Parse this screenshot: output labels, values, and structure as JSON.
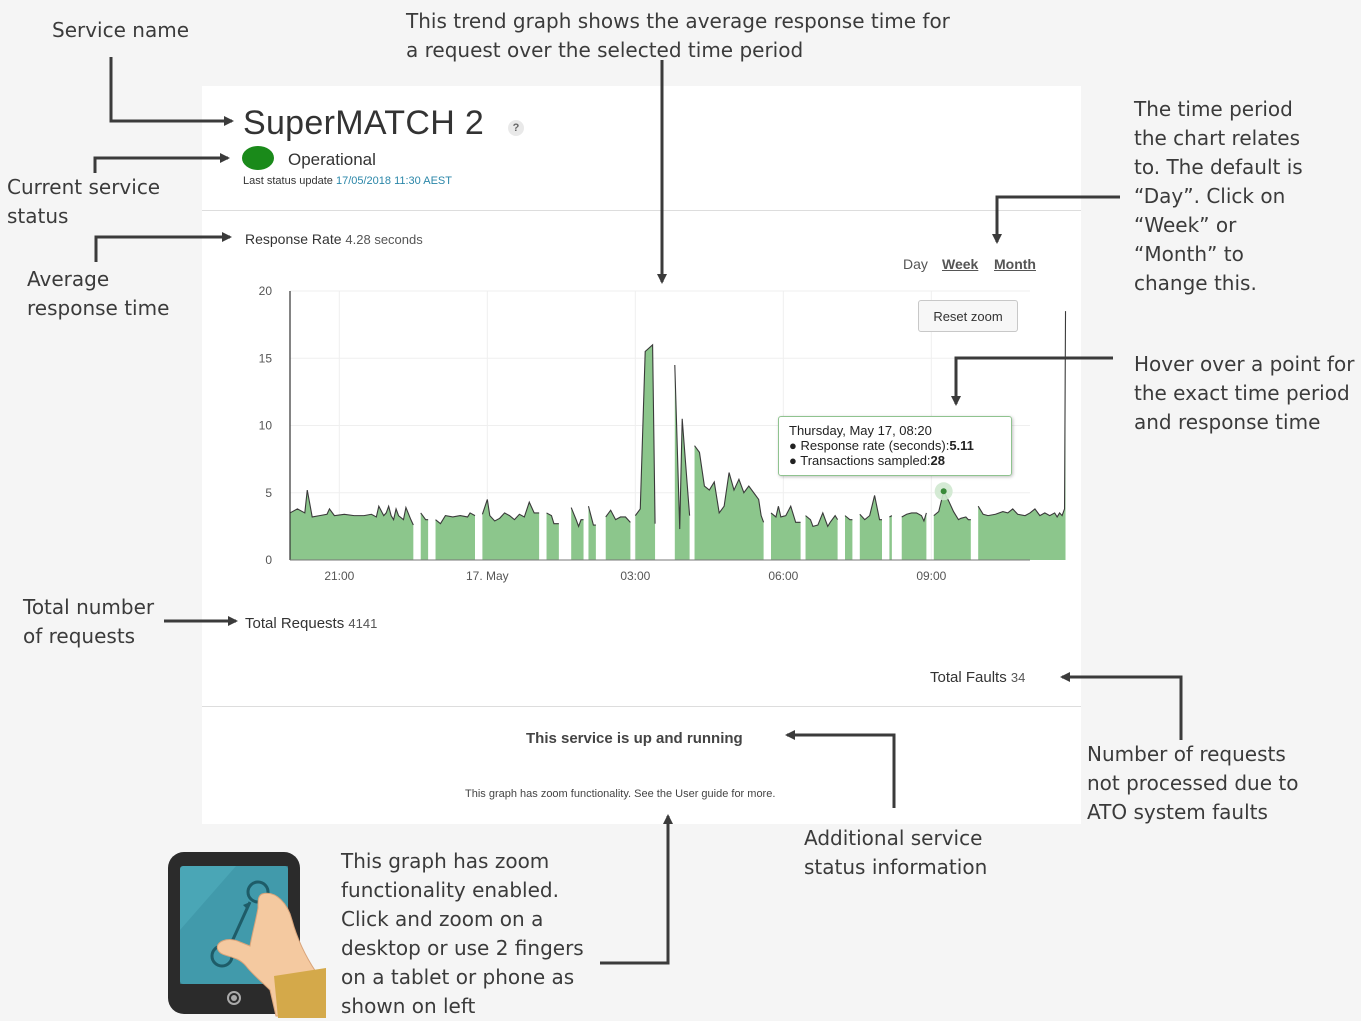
{
  "annotations": {
    "service_name": "Service name",
    "trend_graph": "This trend graph shows the average response time for\na request over the selected time period",
    "current_status": "Current service\nstatus",
    "average_response": "Average\nresponse time",
    "time_period": "The time period\nthe chart relates\nto. The default is\n“Day”. Click on\n“Week” or\n“Month” to\nchange this.",
    "hover": "Hover over a point for\nthe exact time period\nand response time",
    "total_requests": "Total number\nof requests",
    "faults": "Number of requests\nnot processed due to\nATO system faults",
    "additional_info": "Additional service\nstatus information",
    "zoom": "This graph has zoom\nfunctionality enabled.\nClick and zoom on a\ndesktop or use 2 fingers\non a tablet or phone as\nshown on left"
  },
  "service": {
    "title": "SuperMATCH 2",
    "help_icon": "?",
    "status": "Operational",
    "status_color": "#1a8a1a",
    "last_update_label": "Last status update",
    "last_update_value": "17/05/2018 11:30 AEST"
  },
  "response_rate": {
    "label": "Response Rate",
    "value": "4.28 seconds"
  },
  "period_tabs": [
    "Day",
    "Week",
    "Month"
  ],
  "reset_zoom": "Reset zoom",
  "tooltip": {
    "title": "Thursday, May 17, 08:20",
    "line1_label": "Response rate (seconds):",
    "line1_value": "5.11",
    "line2_label": "Transactions sampled:",
    "line2_value": "28"
  },
  "totals": {
    "requests_label": "Total Requests",
    "requests_value": "4141",
    "faults_label": "Total Faults",
    "faults_value": "34"
  },
  "footer": {
    "status_message": "This service is up and running",
    "zoom_note": "This graph has zoom functionality. See the User guide for more."
  },
  "chart_data": {
    "type": "area",
    "color": "#8cc68c",
    "line_color": "#3a3a3a",
    "ylim": [
      0,
      20
    ],
    "yticks": [
      "0",
      "5",
      "10",
      "15",
      "20"
    ],
    "xtick_labels": [
      "21:00",
      "17. May",
      "03:00",
      "06:00",
      "09:00"
    ],
    "xtick_hours": [
      21,
      24,
      27,
      30,
      33
    ],
    "x_range_hours": [
      20.0,
      35.0
    ],
    "series": [
      {
        "segments": [
          [
            [
              20.0,
              3.5
            ],
            [
              20.15,
              3.8
            ],
            [
              20.3,
              3.5
            ],
            [
              20.35,
              5.2
            ],
            [
              20.45,
              3.2
            ],
            [
              20.6,
              3.3
            ],
            [
              20.75,
              3.4
            ],
            [
              20.8,
              3.8
            ],
            [
              20.9,
              3.3
            ],
            [
              21.1,
              3.4
            ],
            [
              21.3,
              3.3
            ],
            [
              21.5,
              3.3
            ],
            [
              21.65,
              3.4
            ],
            [
              21.75,
              3.2
            ],
            [
              21.8,
              4.0
            ],
            [
              21.9,
              3.3
            ],
            [
              21.95,
              3.5
            ],
            [
              22.0,
              4.0
            ],
            [
              22.05,
              3.3
            ],
            [
              22.1,
              3.0
            ],
            [
              22.15,
              3.8
            ],
            [
              22.2,
              3.3
            ],
            [
              22.3,
              3.0
            ],
            [
              22.35,
              3.9
            ],
            [
              22.45,
              3.0
            ],
            [
              22.5,
              2.6
            ]
          ],
          [
            [
              22.65,
              3.5
            ],
            [
              22.75,
              3.0
            ],
            [
              22.8,
              3.0
            ]
          ],
          [
            [
              22.95,
              3.0
            ],
            [
              23.05,
              2.7
            ],
            [
              23.15,
              3.3
            ],
            [
              23.3,
              3.2
            ],
            [
              23.45,
              3.3
            ],
            [
              23.6,
              3.2
            ],
            [
              23.65,
              3.5
            ],
            [
              23.75,
              3.3
            ]
          ],
          [
            [
              23.9,
              3.4
            ],
            [
              24.0,
              4.5
            ],
            [
              24.05,
              3.3
            ],
            [
              24.15,
              2.9
            ],
            [
              24.25,
              3.1
            ],
            [
              24.35,
              3.5
            ],
            [
              24.45,
              3.3
            ],
            [
              24.55,
              3.0
            ],
            [
              24.65,
              3.4
            ],
            [
              24.75,
              3.2
            ],
            [
              24.85,
              4.3
            ],
            [
              24.95,
              3.5
            ],
            [
              25.05,
              3.5
            ]
          ],
          [
            [
              25.2,
              3.5
            ],
            [
              25.3,
              3.3
            ],
            [
              25.35,
              2.7
            ],
            [
              25.45,
              2.7
            ]
          ],
          [
            [
              25.7,
              3.9
            ],
            [
              25.8,
              3.0
            ],
            [
              25.85,
              2.5
            ],
            [
              25.9,
              3.0
            ],
            [
              25.95,
              3.0
            ]
          ],
          [
            [
              26.05,
              4.0
            ],
            [
              26.15,
              2.6
            ],
            [
              26.2,
              2.6
            ]
          ],
          [
            [
              26.4,
              3.2
            ],
            [
              26.5,
              3.7
            ],
            [
              26.6,
              3.0
            ],
            [
              26.7,
              3.2
            ],
            [
              26.8,
              3.2
            ],
            [
              26.9,
              2.8
            ]
          ],
          [
            [
              27.0,
              3.3
            ],
            [
              27.1,
              3.8
            ],
            [
              27.2,
              15.5
            ],
            [
              27.35,
              16.0
            ],
            [
              27.4,
              2.7
            ]
          ],
          [
            [
              27.8,
              14.5
            ],
            [
              27.9,
              2.3
            ],
            [
              27.95,
              10.5
            ],
            [
              28.1,
              3.3
            ]
          ],
          [
            [
              28.2,
              8.5
            ],
            [
              28.3,
              8.0
            ],
            [
              28.4,
              5.5
            ],
            [
              28.5,
              5.2
            ],
            [
              28.6,
              5.8
            ],
            [
              28.7,
              3.5
            ],
            [
              28.8,
              4.0
            ],
            [
              28.9,
              6.5
            ],
            [
              29.0,
              5.2
            ],
            [
              29.1,
              6.0
            ],
            [
              29.2,
              5.0
            ],
            [
              29.3,
              5.5
            ],
            [
              29.4,
              5.0
            ],
            [
              29.5,
              4.5
            ],
            [
              29.55,
              3.3
            ],
            [
              29.6,
              2.8
            ]
          ],
          [
            [
              29.75,
              3.5
            ],
            [
              29.85,
              3.2
            ],
            [
              29.9,
              4.0
            ],
            [
              29.95,
              3.2
            ],
            [
              30.05,
              3.3
            ],
            [
              30.15,
              4.0
            ],
            [
              30.25,
              2.8
            ],
            [
              30.35,
              2.8
            ]
          ],
          [
            [
              30.45,
              3.3
            ],
            [
              30.55,
              3.0
            ],
            [
              30.6,
              2.5
            ],
            [
              30.7,
              2.6
            ],
            [
              30.8,
              3.5
            ],
            [
              30.9,
              2.5
            ],
            [
              30.95,
              2.8
            ],
            [
              31.05,
              3.3
            ],
            [
              31.1,
              3.0
            ]
          ],
          [
            [
              31.25,
              3.3
            ],
            [
              31.35,
              3.0
            ],
            [
              31.4,
              3.0
            ]
          ],
          [
            [
              31.55,
              3.4
            ],
            [
              31.65,
              3.0
            ],
            [
              31.75,
              3.3
            ],
            [
              31.85,
              4.8
            ],
            [
              31.95,
              3.0
            ],
            [
              32.0,
              3.0
            ]
          ],
          [
            [
              32.15,
              3.2
            ],
            [
              32.2,
              3.3
            ]
          ],
          [
            [
              32.4,
              3.2
            ],
            [
              32.5,
              3.4
            ],
            [
              32.6,
              3.5
            ],
            [
              32.7,
              3.5
            ],
            [
              32.8,
              3.3
            ],
            [
              32.85,
              2.9
            ],
            [
              32.9,
              3.5
            ]
          ],
          [
            [
              33.05,
              3.3
            ],
            [
              33.15,
              3.6
            ],
            [
              33.25,
              5.11
            ],
            [
              33.35,
              4.4
            ],
            [
              33.45,
              3.6
            ],
            [
              33.55,
              3.0
            ],
            [
              33.6,
              3.1
            ],
            [
              33.7,
              3.2
            ],
            [
              33.75,
              3.0
            ],
            [
              33.8,
              3.0
            ]
          ],
          [
            [
              33.95,
              4.0
            ],
            [
              34.05,
              3.4
            ],
            [
              34.15,
              3.3
            ],
            [
              34.3,
              3.4
            ],
            [
              34.45,
              3.6
            ],
            [
              34.55,
              3.5
            ],
            [
              34.65,
              3.8
            ],
            [
              34.75,
              3.4
            ],
            [
              34.9,
              3.3
            ],
            [
              35.0,
              3.5
            ],
            [
              35.1,
              3.8
            ],
            [
              35.2,
              3.3
            ],
            [
              35.3,
              3.5
            ],
            [
              35.4,
              3.3
            ],
            [
              35.5,
              3.5
            ],
            [
              35.55,
              3.2
            ],
            [
              35.6,
              3.5
            ],
            [
              35.65,
              3.3
            ],
            [
              35.7,
              3.8
            ],
            [
              35.72,
              18.5
            ]
          ]
        ]
      }
    ],
    "highlight_point": [
      33.25,
      5.11
    ]
  }
}
